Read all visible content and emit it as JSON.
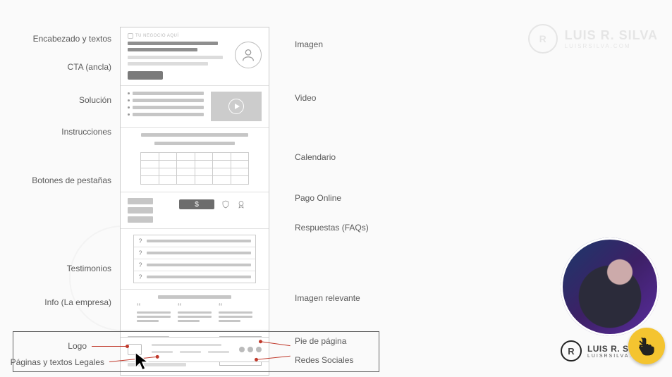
{
  "labels_left": {
    "header": "Encabezado y textos",
    "cta": "CTA (ancla)",
    "solution": "Solución",
    "instructions": "Instrucciones",
    "tabs": "Botones de pestañas",
    "testimonials": "Testimonios",
    "company": "Info (La empresa)"
  },
  "labels_right": {
    "image": "Imagen",
    "video": "Video",
    "calendar": "Calendario",
    "payment": "Pago Online",
    "faqs": "Respuestas (FAQs)",
    "image_rel": "Imagen relevante"
  },
  "footer_labels": {
    "logo": "Logo",
    "legal": "Páginas y textos Legales",
    "footer": "Pie de página",
    "social": "Redes Sociales"
  },
  "wire": {
    "header_logo_text": "TU NEGOCIO AQUÍ",
    "pay_symbol": "$",
    "faq_mark": "?",
    "quote_mark": "“"
  },
  "brand": {
    "initial": "R",
    "name": "LUIS R. SILVA",
    "site": "LUISRSILVA.COM"
  }
}
